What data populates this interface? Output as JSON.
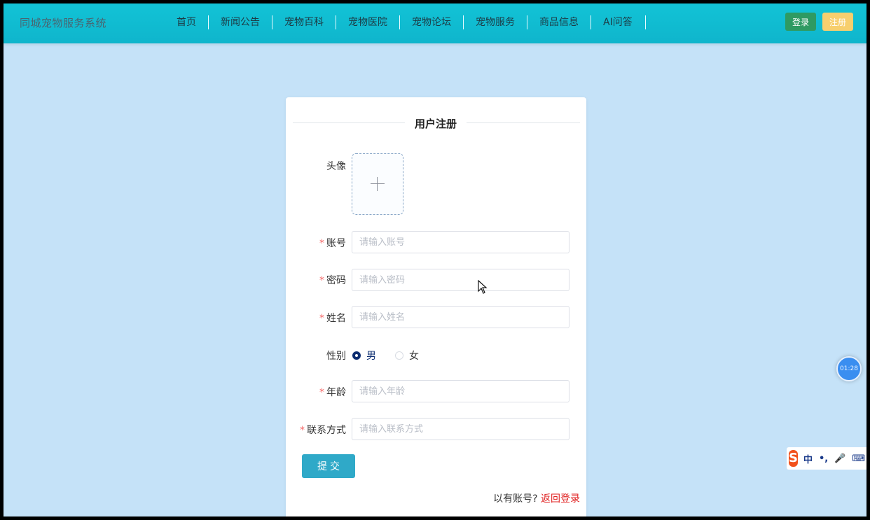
{
  "header": {
    "brand": "同城宠物服务系统",
    "menu": [
      "首页",
      "新闻公告",
      "宠物百科",
      "宠物医院",
      "宠物论坛",
      "宠物服务",
      "商品信息",
      "AI问答"
    ],
    "login_label": "登录",
    "register_label": "注册"
  },
  "form": {
    "title": "用户注册",
    "avatar_label": "头像",
    "fields": {
      "account": {
        "label": "账号",
        "placeholder": "请输入账号",
        "required": true
      },
      "password": {
        "label": "密码",
        "placeholder": "请输入密码",
        "required": true
      },
      "name": {
        "label": "姓名",
        "placeholder": "请输入姓名",
        "required": true
      },
      "age": {
        "label": "年龄",
        "placeholder": "请输入年龄",
        "required": true
      },
      "contact": {
        "label": "联系方式",
        "placeholder": "请输入联系方式",
        "required": true
      }
    },
    "gender": {
      "label": "性别",
      "options": [
        "男",
        "女"
      ],
      "selected": "男"
    },
    "required_mark": "*",
    "submit_label": "提交",
    "have_account_text": "以有账号?",
    "back_login_label": "返回登录"
  },
  "widgets": {
    "timer_text": "01:28",
    "ime": {
      "logo": "S",
      "items": [
        "中",
        "•,",
        "🎤",
        "⌨"
      ]
    }
  },
  "colors": {
    "navbar": "#12c3d6",
    "page_bg": "#c5e2f8",
    "login_btn": "#2e9a62",
    "register_btn": "#f7cf6e",
    "submit_btn": "#2fa9c8",
    "link": "#e02020",
    "required": "#f56c6c"
  }
}
